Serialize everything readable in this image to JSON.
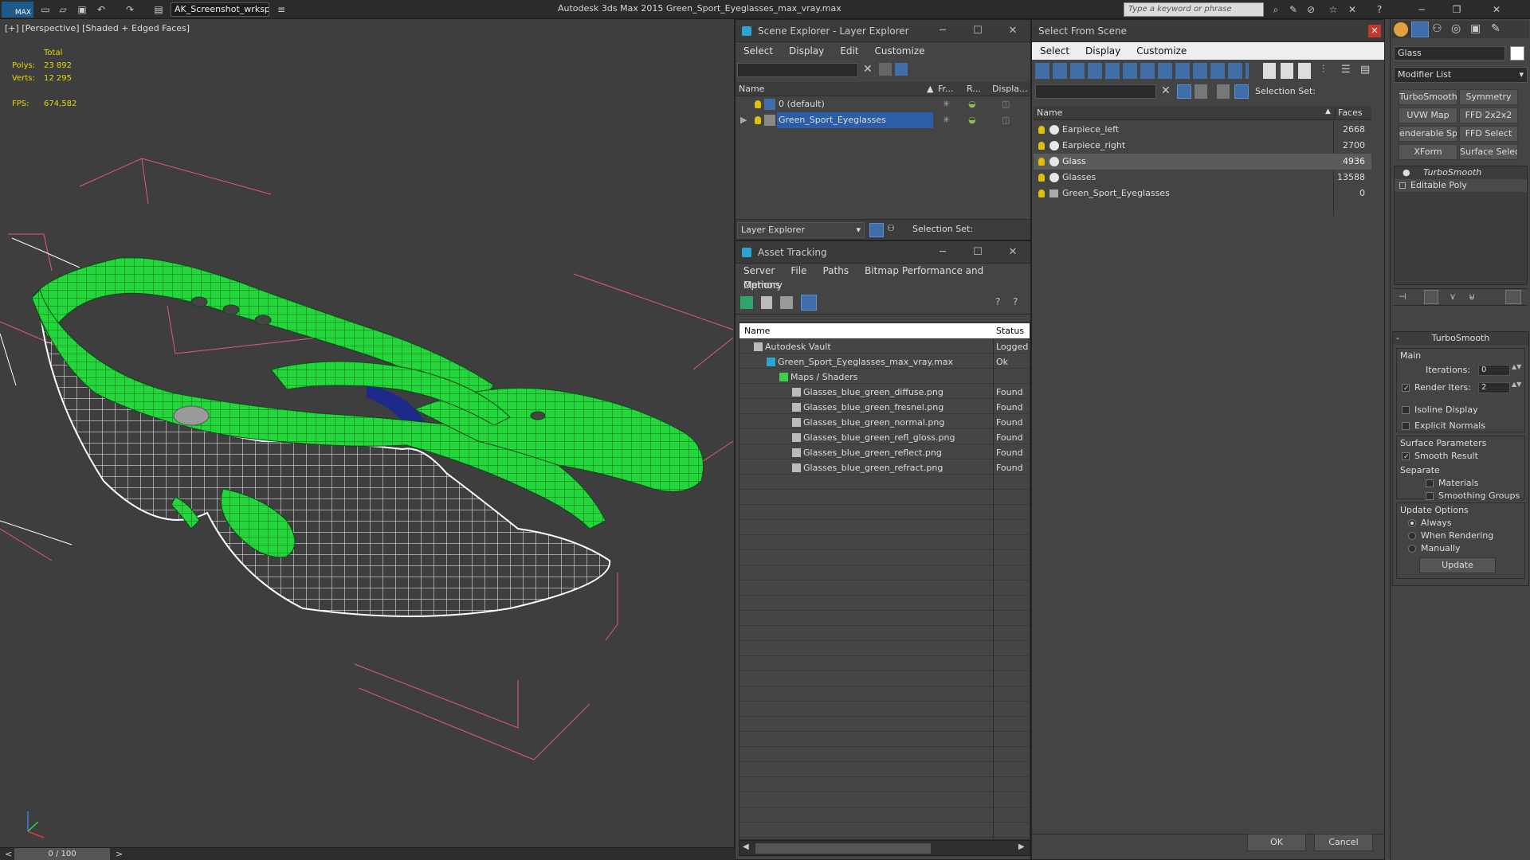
{
  "titlebar": {
    "workspace": "AK_Screenshot_wrksp",
    "app_title": "Autodesk 3ds Max  2015    Green_Sport_Eyeglasses_max_vray.max",
    "search_placeholder": "Type a keyword or phrase",
    "logo": "MAX"
  },
  "viewport": {
    "label": "[+] [Perspective] [Shaded + Edged Faces]",
    "stats_total": "Total",
    "polys_label": "Polys:",
    "polys_value": "23 892",
    "verts_label": "Verts:",
    "verts_value": "12 295",
    "fps_label": "FPS:",
    "fps_value": "674,582",
    "model_color": "#22d63c",
    "wire_color": "#ffffff",
    "bbox_color": "#e05a7a"
  },
  "timeline": {
    "frame": "0 / 100",
    "prev": "<",
    "next": ">"
  },
  "scene_explorer": {
    "title": "Scene Explorer - Layer Explorer",
    "menu": [
      "Select",
      "Display",
      "Edit",
      "Customize"
    ],
    "columns": [
      "Name",
      "Fr...",
      "R...",
      "Displa..."
    ],
    "layers": [
      {
        "name": "0 (default)",
        "selected": false
      },
      {
        "name": "Green_Sport_Eyeglasses",
        "selected": true
      }
    ],
    "footer_dropdown": "Layer Explorer",
    "selection_set_label": "Selection Set:"
  },
  "asset_tracking": {
    "title": "Asset Tracking",
    "menu": [
      "Server",
      "File",
      "Paths",
      "Bitmap Performance and Memory"
    ],
    "menu2": "Options",
    "columns": [
      "Name",
      "Status"
    ],
    "rows": [
      {
        "name": "Autodesk Vault",
        "status": "Logged",
        "indent": 1
      },
      {
        "name": "Green_Sport_Eyeglasses_max_vray.max",
        "status": "Ok",
        "indent": 2
      },
      {
        "name": "Maps / Shaders",
        "status": "",
        "indent": 3
      },
      {
        "name": "Glasses_blue_green_diffuse.png",
        "status": "Found",
        "indent": 4
      },
      {
        "name": "Glasses_blue_green_fresnel.png",
        "status": "Found",
        "indent": 4
      },
      {
        "name": "Glasses_blue_green_normal.png",
        "status": "Found",
        "indent": 4
      },
      {
        "name": "Glasses_blue_green_refl_gloss.png",
        "status": "Found",
        "indent": 4
      },
      {
        "name": "Glasses_blue_green_reflect.png",
        "status": "Found",
        "indent": 4
      },
      {
        "name": "Glasses_blue_green_refract.png",
        "status": "Found",
        "indent": 4
      }
    ]
  },
  "select_from_scene": {
    "title": "Select From Scene",
    "menu": [
      "Select",
      "Display",
      "Customize"
    ],
    "selection_set_label": "Selection Set:",
    "columns": [
      "Name",
      "Faces"
    ],
    "rows": [
      {
        "name": "Earpiece_left",
        "faces": "2668",
        "selected": false
      },
      {
        "name": "Earpiece_right",
        "faces": "2700",
        "selected": false
      },
      {
        "name": "Glass",
        "faces": "4936",
        "selected": true
      },
      {
        "name": "Glasses",
        "faces": "13588",
        "selected": false
      },
      {
        "name": "Green_Sport_Eyeglasses",
        "faces": "0",
        "selected": false
      }
    ],
    "ok": "OK",
    "cancel": "Cancel"
  },
  "command_panel": {
    "object_name": "Glass",
    "modifier_list": "Modifier List",
    "buttons": [
      "TurboSmooth",
      "Symmetry",
      "UVW Map",
      "FFD 2x2x2",
      "enderable Splir",
      "FFD Select",
      "XForm",
      "Surface Select"
    ],
    "stack": [
      "TurboSmooth",
      "Editable Poly"
    ],
    "rollout_title": "TurboSmooth",
    "main_label": "Main",
    "iterations_label": "Iterations:",
    "iterations_value": "0",
    "render_iters_label": "Render Iters:",
    "render_iters_value": "2",
    "isoline": "Isoline Display",
    "explicit_normals": "Explicit Normals",
    "surface_params": "Surface Parameters",
    "smooth_result": "Smooth Result",
    "separate": "Separate",
    "materials": "Materials",
    "smoothing_groups": "Smoothing Groups",
    "update_options": "Update Options",
    "always": "Always",
    "when_rendering": "When Rendering",
    "manually": "Manually",
    "update_button": "Update"
  }
}
